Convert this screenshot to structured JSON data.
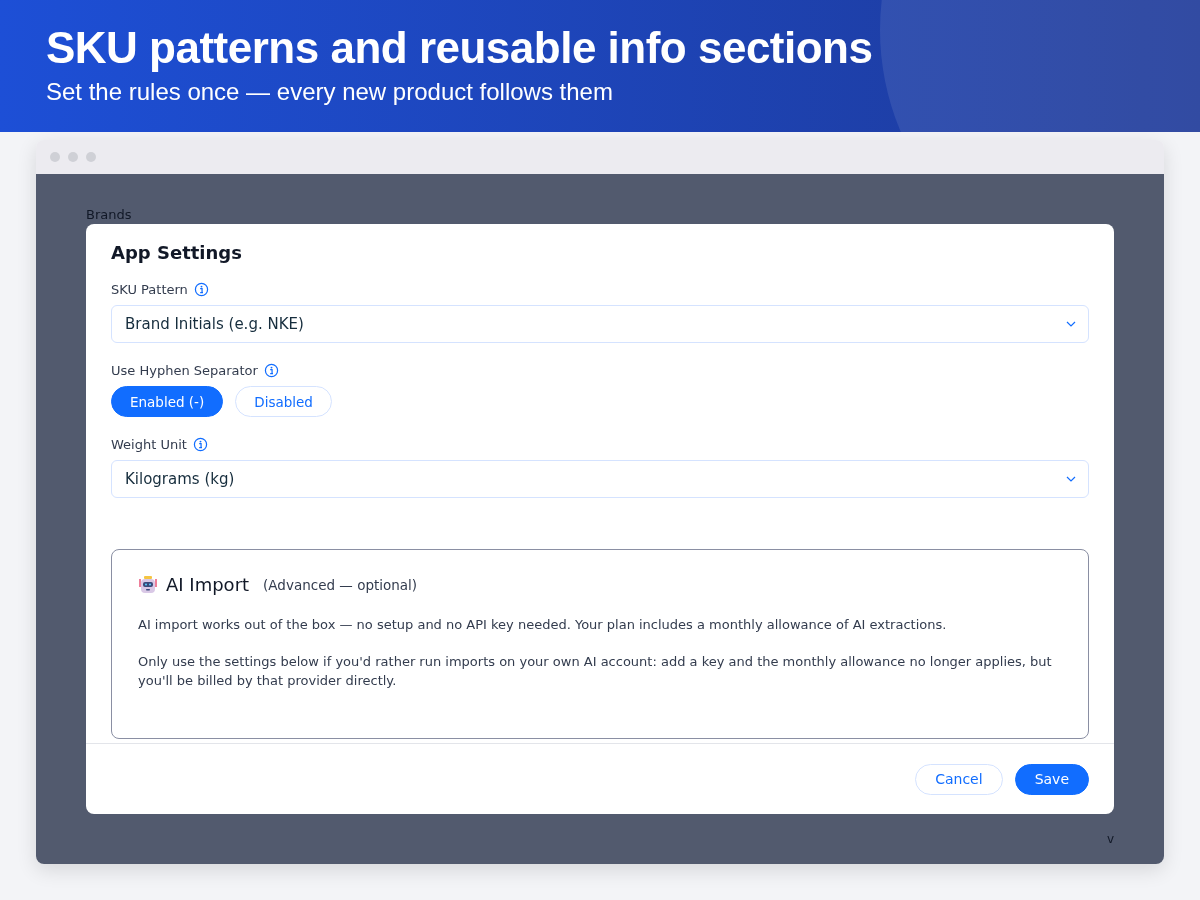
{
  "banner": {
    "title": "SKU patterns and reusable info sections",
    "subtitle": "Set the rules once — every new product follows them"
  },
  "background": {
    "heading": "Brands",
    "corner_mark": "v"
  },
  "modal": {
    "title": "App Settings",
    "fields": [
      {
        "kind": "select",
        "label": "SKU Pattern",
        "value": "Brand Initials (e.g. NKE)"
      },
      {
        "kind": "toggle",
        "label": "Use Hyphen Separator",
        "options": [
          {
            "label": "Enabled (-)",
            "selected": true
          },
          {
            "label": "Disabled",
            "selected": false
          }
        ]
      },
      {
        "kind": "select",
        "label": "Weight Unit",
        "value": "Kilograms (kg)"
      }
    ],
    "ai_section": {
      "title": "AI Import",
      "note": "(Advanced — optional)",
      "paragraphs": [
        "AI import works out of the box — no setup and no API key needed. Your plan includes a monthly allowance of AI extractions.",
        "Only use the settings below if you'd rather run imports on your own AI account: add a key and the monthly allowance no longer applies, but you'll be billed by that provider directly."
      ]
    },
    "buttons": [
      {
        "kind": "secondary",
        "label": "Cancel"
      },
      {
        "kind": "primary",
        "label": "Save"
      }
    ]
  }
}
